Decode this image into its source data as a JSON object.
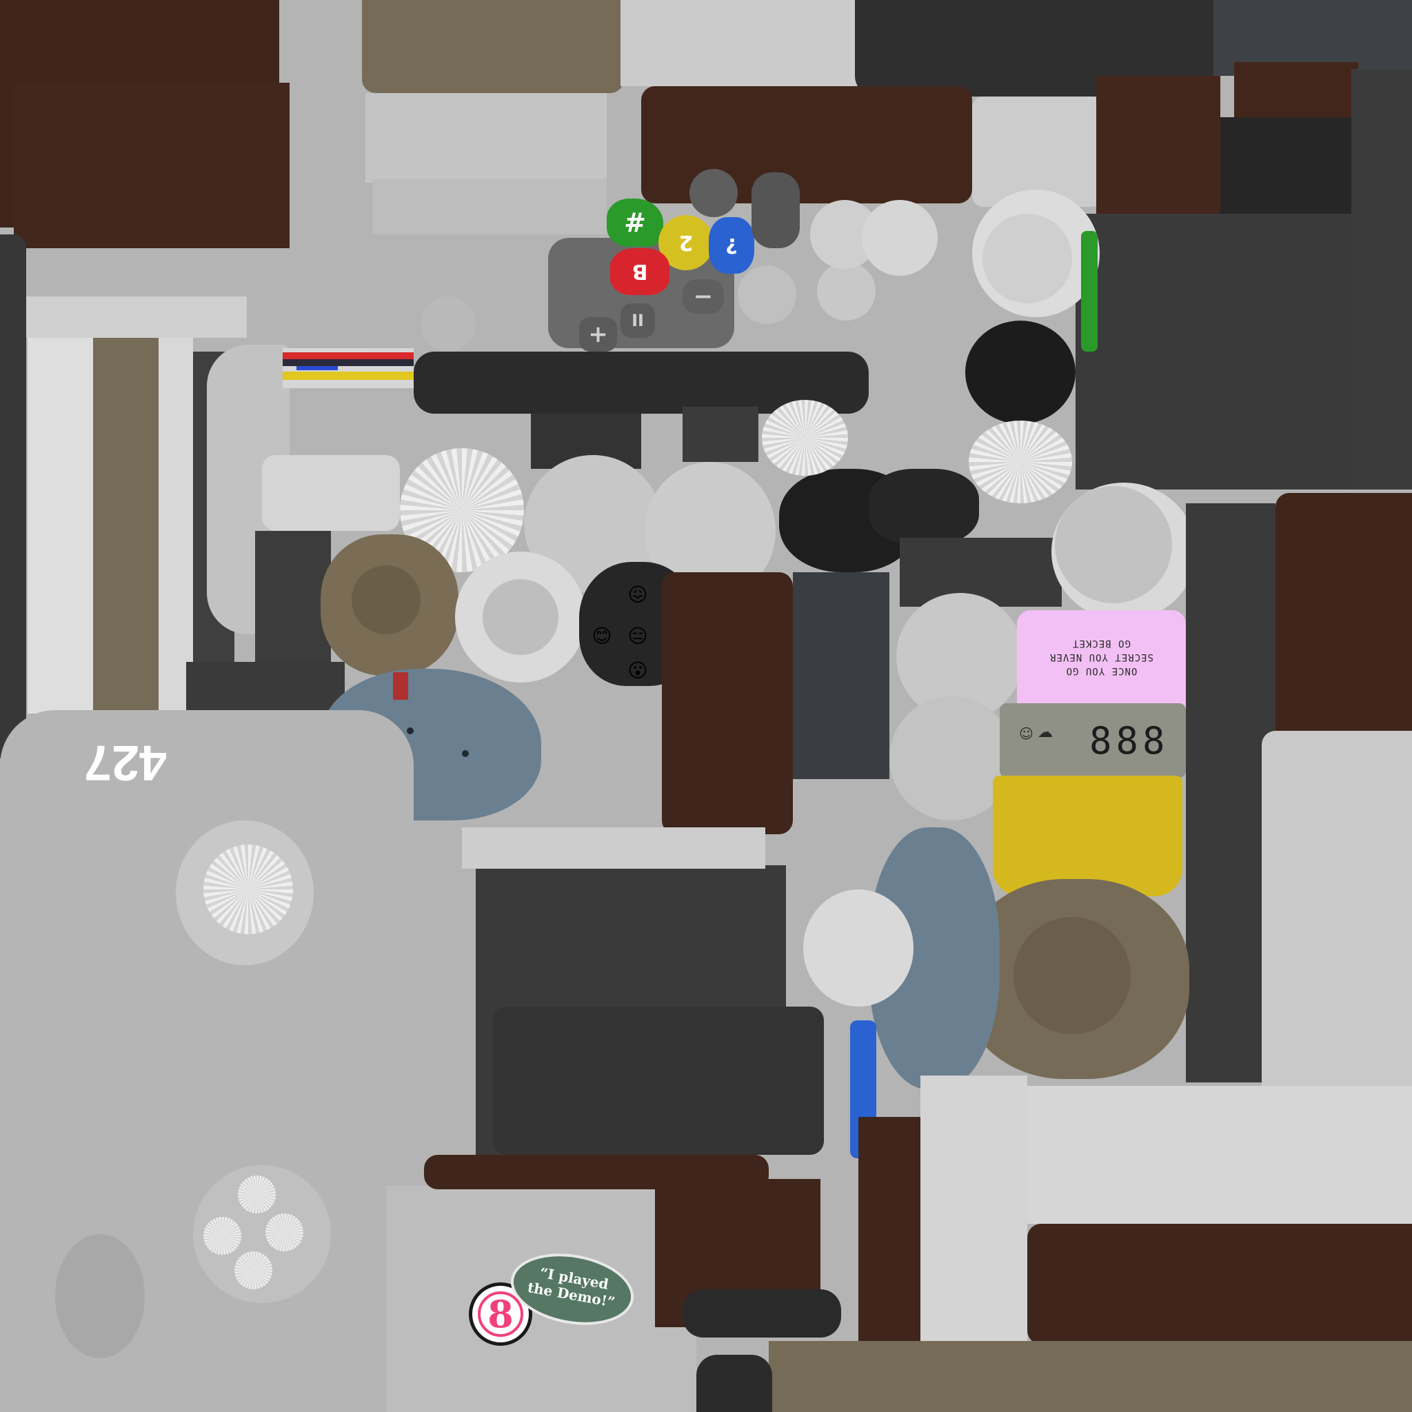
{
  "colors": {
    "brown": "#3f251b",
    "tan": "#766b57",
    "light_gray": "#c5c5c5",
    "mid_gray": "#9c9c9c",
    "dark_gray": "#3a3a3a",
    "charcoal": "#2a2a2a",
    "blue_gray": "#6a7f90",
    "green": "#2a9a2a",
    "yellow": "#d5b81e",
    "blue": "#2a62d2",
    "red": "#d8242c",
    "pink": "#f2c0f4",
    "lcd": "#8f9187",
    "sticker_green": "#557764",
    "sticker_pink": "#f0427a"
  },
  "keys": {
    "green": "#",
    "yellow": "2",
    "blue": "?",
    "red": "B",
    "minus": "−",
    "pause": "II",
    "plus": "+"
  },
  "emoji_pad": {
    "top": "😖",
    "left": "😊",
    "center": "😑",
    "right": "😟",
    "bottom": "😮"
  },
  "body_number": "427",
  "pink_label": {
    "line1": "ONCE YOU GO",
    "line2": "SECRET YOU NEVER",
    "line3": "GO BECKET"
  },
  "lcd": {
    "digits": "888",
    "face_icon": "smiley-icon",
    "weather_icon": "rain-cloud-icon"
  },
  "sticker": {
    "badge_number": "8",
    "line1": "“I played",
    "line2": "the Demo!”"
  }
}
